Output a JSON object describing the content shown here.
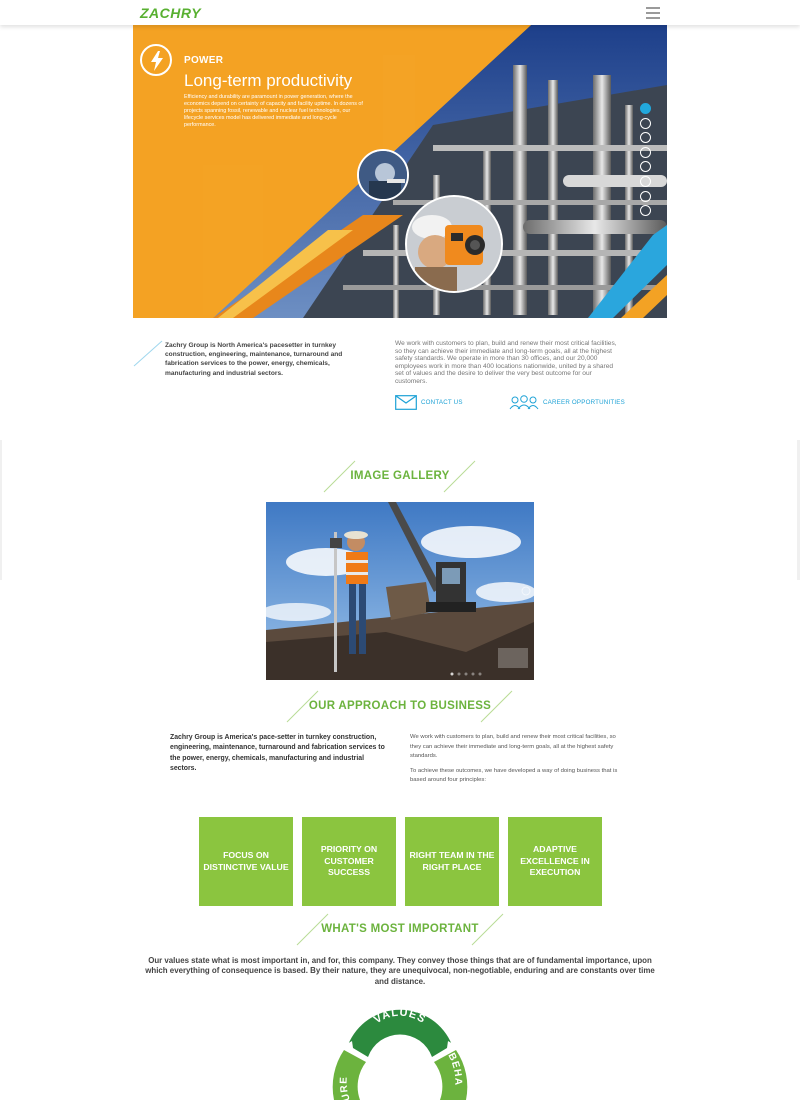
{
  "header": {
    "logo": "ZACHRY",
    "menu_icon": "hamburger-icon"
  },
  "hero": {
    "label": "POWER",
    "title": "Long-term productivity",
    "body": "Efficiency and durability are paramount in power generation, where the economics depend on certainty of capacity and facility uptime. In dozens of projects spanning fossil, renewable and nuclear fuel technologies, our lifecycle services model has delivered immediate and long-cycle performance.",
    "icon": "lightning-bolt-icon",
    "slide_count": 8,
    "active_slide": 1
  },
  "intro": {
    "left": "Zachry Group is North America's pacesetter in turnkey construction, engineering, maintenance, turnaround and fabrication services to the power, energy, chemicals, manufacturing and industrial sectors.",
    "right": "We work with customers to plan, build and renew their most critical facilities, so they can achieve their immediate and long-term goals, all at the highest safety standards. We operate in more than 30 offices, and our 20,000 employees work in more than 400 locations nationwide, united by a shared set of values and the desire to deliver the very best outcome for our customers.",
    "contact_label": "CONTACT US",
    "careers_label": "CAREER OPPORTUNITIES"
  },
  "gallery": {
    "title": "IMAGE GALLERY"
  },
  "approach": {
    "title": "OUR APPROACH TO BUSINESS",
    "left": "Zachry Group is America's pace-setter in turnkey construction, engineering, maintenance, turnaround and fabrication services to the power, energy, chemicals, manufacturing and industrial sectors.",
    "right_p1": "We work with customers to plan, build and renew their most critical facilities, so they can achieve their immediate and long-term goals, all at the highest safety standards.",
    "right_p2": "To achieve these outcomes, we have developed a way of doing business that is based around four principles:",
    "principles": [
      "FOCUS ON DISTINCTIVE VALUE",
      "PRIORITY ON CUSTOMER SUCCESS",
      "RIGHT TEAM IN THE RIGHT PLACE",
      "ADAPTIVE EXCELLENCE IN EXECUTION"
    ]
  },
  "important": {
    "title": "WHAT'S MOST IMPORTANT",
    "body": "Our values state what is most important in, and for, this company. They convey those things that are of fundamental importance, upon which everything of consequence is based. By their nature, they are unequivocal, non-negotiable, enduring and are constants over time and distance.",
    "wheel_values": "VALUES",
    "wheel_behaviors": "BEHA",
    "wheel_culture": "URE"
  },
  "colors": {
    "green": "#6cb33e",
    "box_green": "#8bc53f",
    "hero_orange": "#f3a224",
    "blue": "#1ea2d6"
  }
}
